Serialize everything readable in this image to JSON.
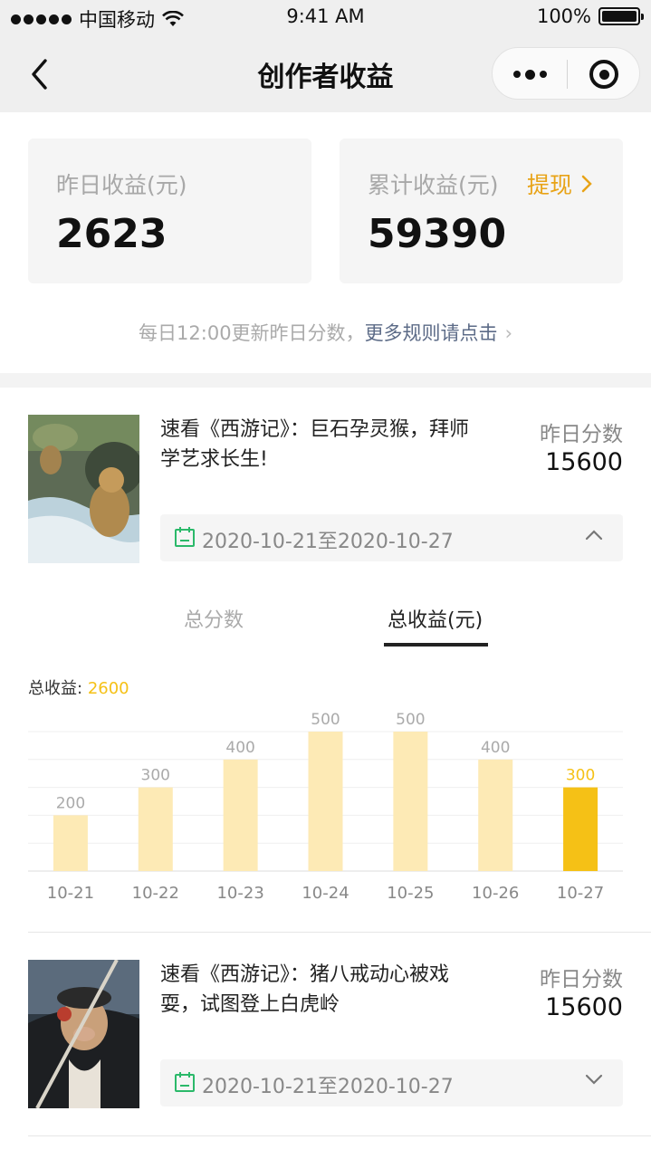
{
  "status_bar": {
    "carrier": "中国移动",
    "time": "9:41 AM",
    "battery": "100%"
  },
  "nav": {
    "title": "创作者收益"
  },
  "summary": {
    "yesterday_label": "昨日收益(元)",
    "yesterday_value": "2623",
    "total_label": "累计收益(元)",
    "total_value": "59390",
    "withdraw_label": "提现"
  },
  "rule_note": {
    "prefix": "每日12:00更新昨日分数，",
    "link": "更多规则请点击"
  },
  "videos": [
    {
      "title": "速看《西游记》：巨石孕灵猴，拜师学艺求长生!",
      "score_label": "昨日分数",
      "score_value": "15600",
      "date_range": "2020-10-21至2020-10-27",
      "expanded": true
    },
    {
      "title": "速看《西游记》：猪八戒动心被戏耍，试图登上白虎岭",
      "score_label": "昨日分数",
      "score_value": "15600",
      "date_range": "2020-10-21至2020-10-27",
      "expanded": false
    }
  ],
  "tabs": [
    {
      "label": "总分数",
      "active": false
    },
    {
      "label": "总收益(元)",
      "active": true
    }
  ],
  "chart_total": {
    "label": "总收益:",
    "value": "2600"
  },
  "colors": {
    "accent": "#f5c116",
    "bar_light": "#fdeab5",
    "withdraw": "#e8a317",
    "calendar_green": "#2bb96a"
  },
  "chart_data": {
    "type": "bar",
    "categories": [
      "10-21",
      "10-22",
      "10-23",
      "10-24",
      "10-25",
      "10-26",
      "10-27"
    ],
    "values": [
      200,
      300,
      400,
      500,
      500,
      400,
      300
    ],
    "highlight_index": 6,
    "ylim": [
      0,
      500
    ],
    "grid": true,
    "data_labels": true
  }
}
